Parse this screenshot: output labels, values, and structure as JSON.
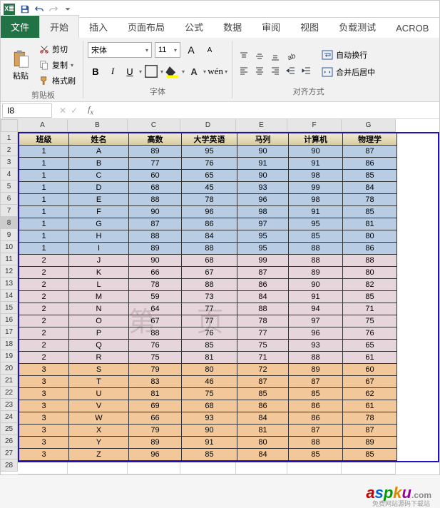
{
  "qat": {
    "excel_badge": "X≣"
  },
  "tabs": {
    "file": "文件",
    "items": [
      "开始",
      "插入",
      "页面布局",
      "公式",
      "数据",
      "审阅",
      "视图",
      "负载测试",
      "ACROB"
    ]
  },
  "ribbon": {
    "clipboard": {
      "paste": "粘贴",
      "cut": "剪切",
      "copy": "复制",
      "format_painter": "格式刷",
      "label": "剪贴板"
    },
    "font": {
      "name": "宋体",
      "size": "11",
      "label": "字体",
      "b": "B",
      "i": "I",
      "u": "U",
      "inc": "A",
      "dec": "A"
    },
    "alignment": {
      "wrap": "自动换行",
      "merge": "合并后居中",
      "label": "对齐方式"
    }
  },
  "namebox": "I8",
  "formula": "",
  "cols": [
    "A",
    "B",
    "C",
    "D",
    "E",
    "F",
    "G"
  ],
  "headers": [
    "班级",
    "姓名",
    "高数",
    "大学英语",
    "马列",
    "计算机",
    "物理学"
  ],
  "rows": [
    {
      "g": 1,
      "c": [
        "1",
        "A",
        "89",
        "95",
        "90",
        "90",
        "87"
      ]
    },
    {
      "g": 1,
      "c": [
        "1",
        "B",
        "77",
        "76",
        "91",
        "91",
        "86"
      ]
    },
    {
      "g": 1,
      "c": [
        "1",
        "C",
        "60",
        "65",
        "90",
        "98",
        "85"
      ]
    },
    {
      "g": 1,
      "c": [
        "1",
        "D",
        "68",
        "45",
        "93",
        "99",
        "84"
      ]
    },
    {
      "g": 1,
      "c": [
        "1",
        "E",
        "88",
        "78",
        "96",
        "98",
        "78"
      ]
    },
    {
      "g": 1,
      "c": [
        "1",
        "F",
        "90",
        "96",
        "98",
        "91",
        "85"
      ]
    },
    {
      "g": 1,
      "c": [
        "1",
        "G",
        "87",
        "86",
        "97",
        "95",
        "81"
      ]
    },
    {
      "g": 1,
      "c": [
        "1",
        "H",
        "88",
        "84",
        "95",
        "85",
        "80"
      ]
    },
    {
      "g": 1,
      "c": [
        "1",
        "I",
        "89",
        "88",
        "95",
        "88",
        "86"
      ]
    },
    {
      "g": 2,
      "c": [
        "2",
        "J",
        "90",
        "68",
        "99",
        "88",
        "88"
      ]
    },
    {
      "g": 2,
      "c": [
        "2",
        "K",
        "66",
        "67",
        "87",
        "89",
        "80"
      ]
    },
    {
      "g": 2,
      "c": [
        "2",
        "L",
        "78",
        "88",
        "86",
        "90",
        "82"
      ]
    },
    {
      "g": 2,
      "c": [
        "2",
        "M",
        "59",
        "73",
        "84",
        "91",
        "85"
      ]
    },
    {
      "g": 2,
      "c": [
        "2",
        "N",
        "64",
        "77",
        "88",
        "94",
        "71"
      ]
    },
    {
      "g": 2,
      "c": [
        "2",
        "O",
        "67",
        "77",
        "78",
        "97",
        "75"
      ]
    },
    {
      "g": 2,
      "c": [
        "2",
        "P",
        "88",
        "76",
        "77",
        "96",
        "76"
      ]
    },
    {
      "g": 2,
      "c": [
        "2",
        "Q",
        "76",
        "85",
        "75",
        "93",
        "65"
      ]
    },
    {
      "g": 2,
      "c": [
        "2",
        "R",
        "75",
        "81",
        "71",
        "88",
        "61"
      ]
    },
    {
      "g": 3,
      "c": [
        "3",
        "S",
        "79",
        "80",
        "72",
        "89",
        "60"
      ]
    },
    {
      "g": 3,
      "c": [
        "3",
        "T",
        "83",
        "46",
        "87",
        "87",
        "67"
      ]
    },
    {
      "g": 3,
      "c": [
        "3",
        "U",
        "81",
        "75",
        "85",
        "85",
        "62"
      ]
    },
    {
      "g": 3,
      "c": [
        "3",
        "V",
        "69",
        "68",
        "86",
        "86",
        "61"
      ]
    },
    {
      "g": 3,
      "c": [
        "3",
        "W",
        "66",
        "93",
        "84",
        "86",
        "78"
      ]
    },
    {
      "g": 3,
      "c": [
        "3",
        "X",
        "79",
        "90",
        "81",
        "87",
        "87"
      ]
    },
    {
      "g": 3,
      "c": [
        "3",
        "Y",
        "89",
        "91",
        "80",
        "88",
        "89"
      ]
    },
    {
      "g": 3,
      "c": [
        "3",
        "Z",
        "96",
        "85",
        "84",
        "85",
        "85"
      ]
    }
  ],
  "selected_row": 8,
  "watermark": "第 页",
  "footer": {
    "brand_a": "a",
    "brand_s": "s",
    "brand_p": "p",
    "brand_k": "k",
    "brand_u": "u",
    "brand_com": ".com",
    "sub": "免费网站源码下载站"
  }
}
